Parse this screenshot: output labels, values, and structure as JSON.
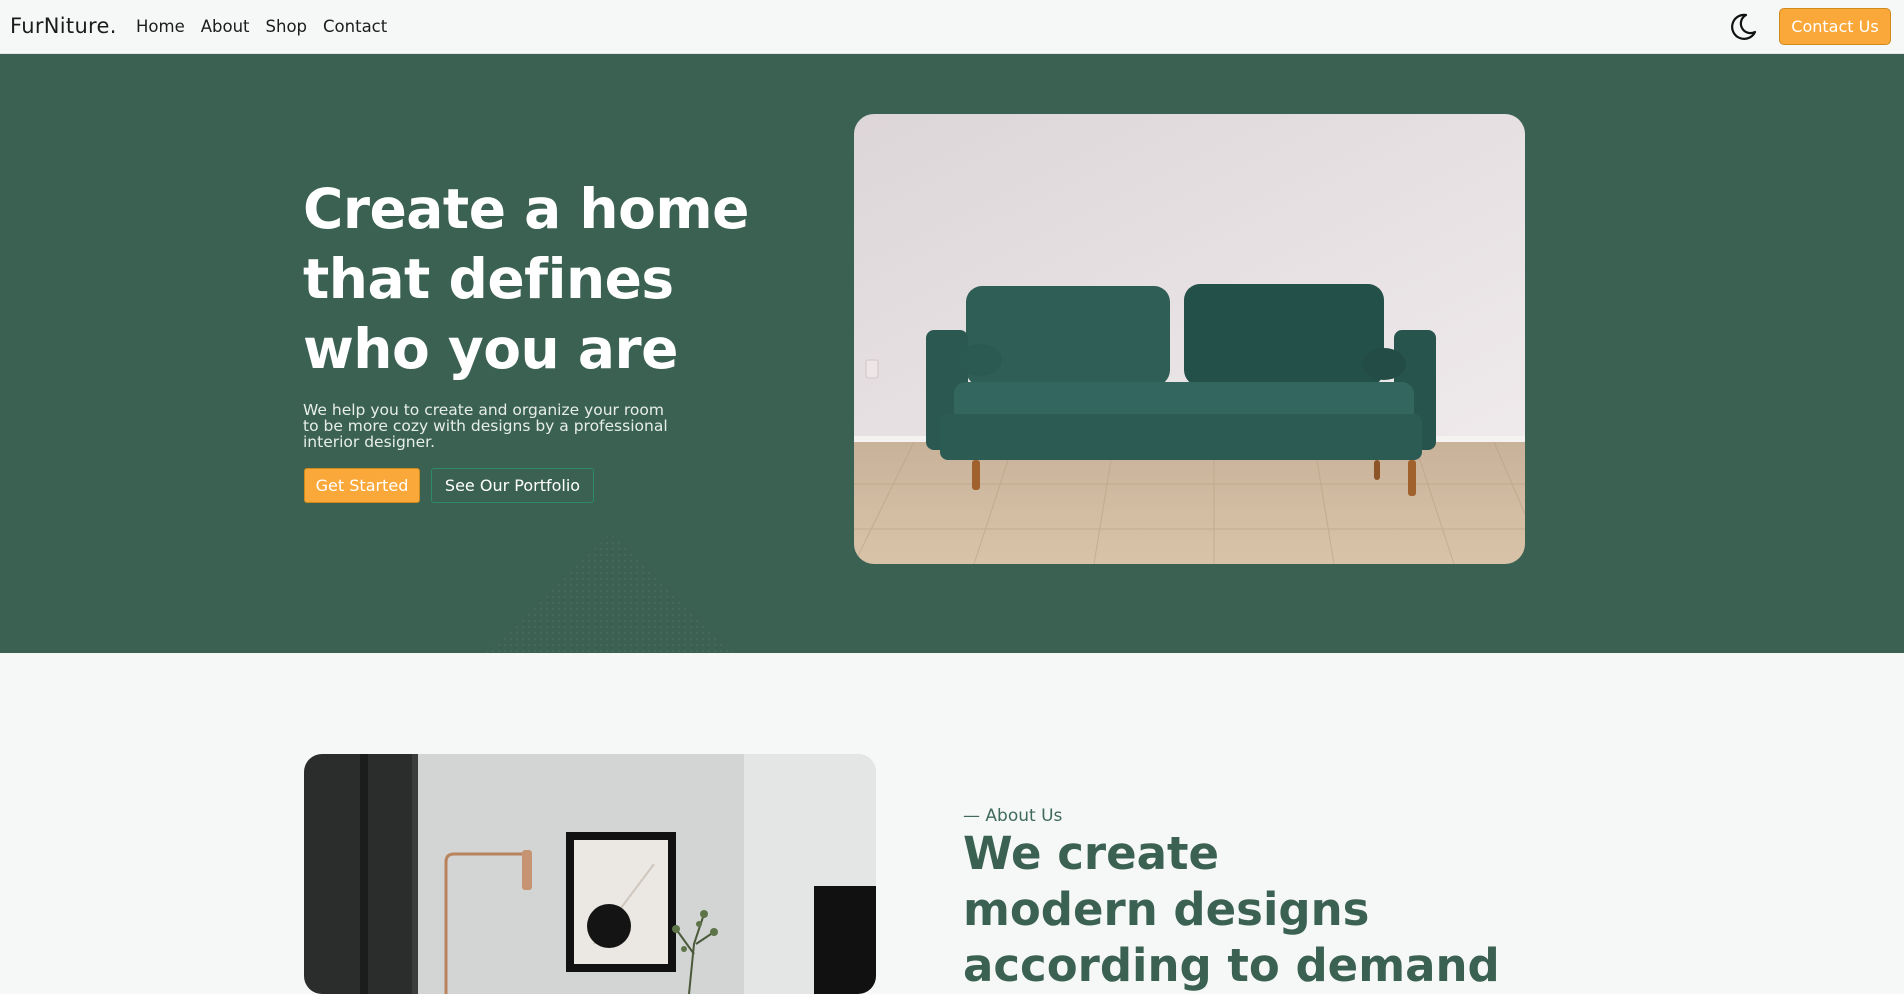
{
  "nav": {
    "brand": "FurNiture.",
    "links": [
      "Home",
      "About",
      "Shop",
      "Contact"
    ],
    "theme_toggle_icon": "moon-icon",
    "contact_label": "Contact Us"
  },
  "hero": {
    "title_lines": [
      "Create a home",
      "that defines",
      "who you are"
    ],
    "text_lines": [
      "We help you to create and organize your room",
      "to be more cozy with designs by a professional",
      "interior designer."
    ],
    "primary_label": "Get Started",
    "secondary_label": "See Our Portfolio",
    "image": "green-velvet-sofa-photo"
  },
  "about": {
    "label": "— About Us",
    "title_lines": [
      "We create",
      "modern designs",
      "according to demand"
    ],
    "image": "interior-lamp-frame-photo"
  },
  "colors": {
    "brand_green": "#3b6152",
    "accent_orange": "#fba83a",
    "page_bg": "#f6f8f8"
  }
}
